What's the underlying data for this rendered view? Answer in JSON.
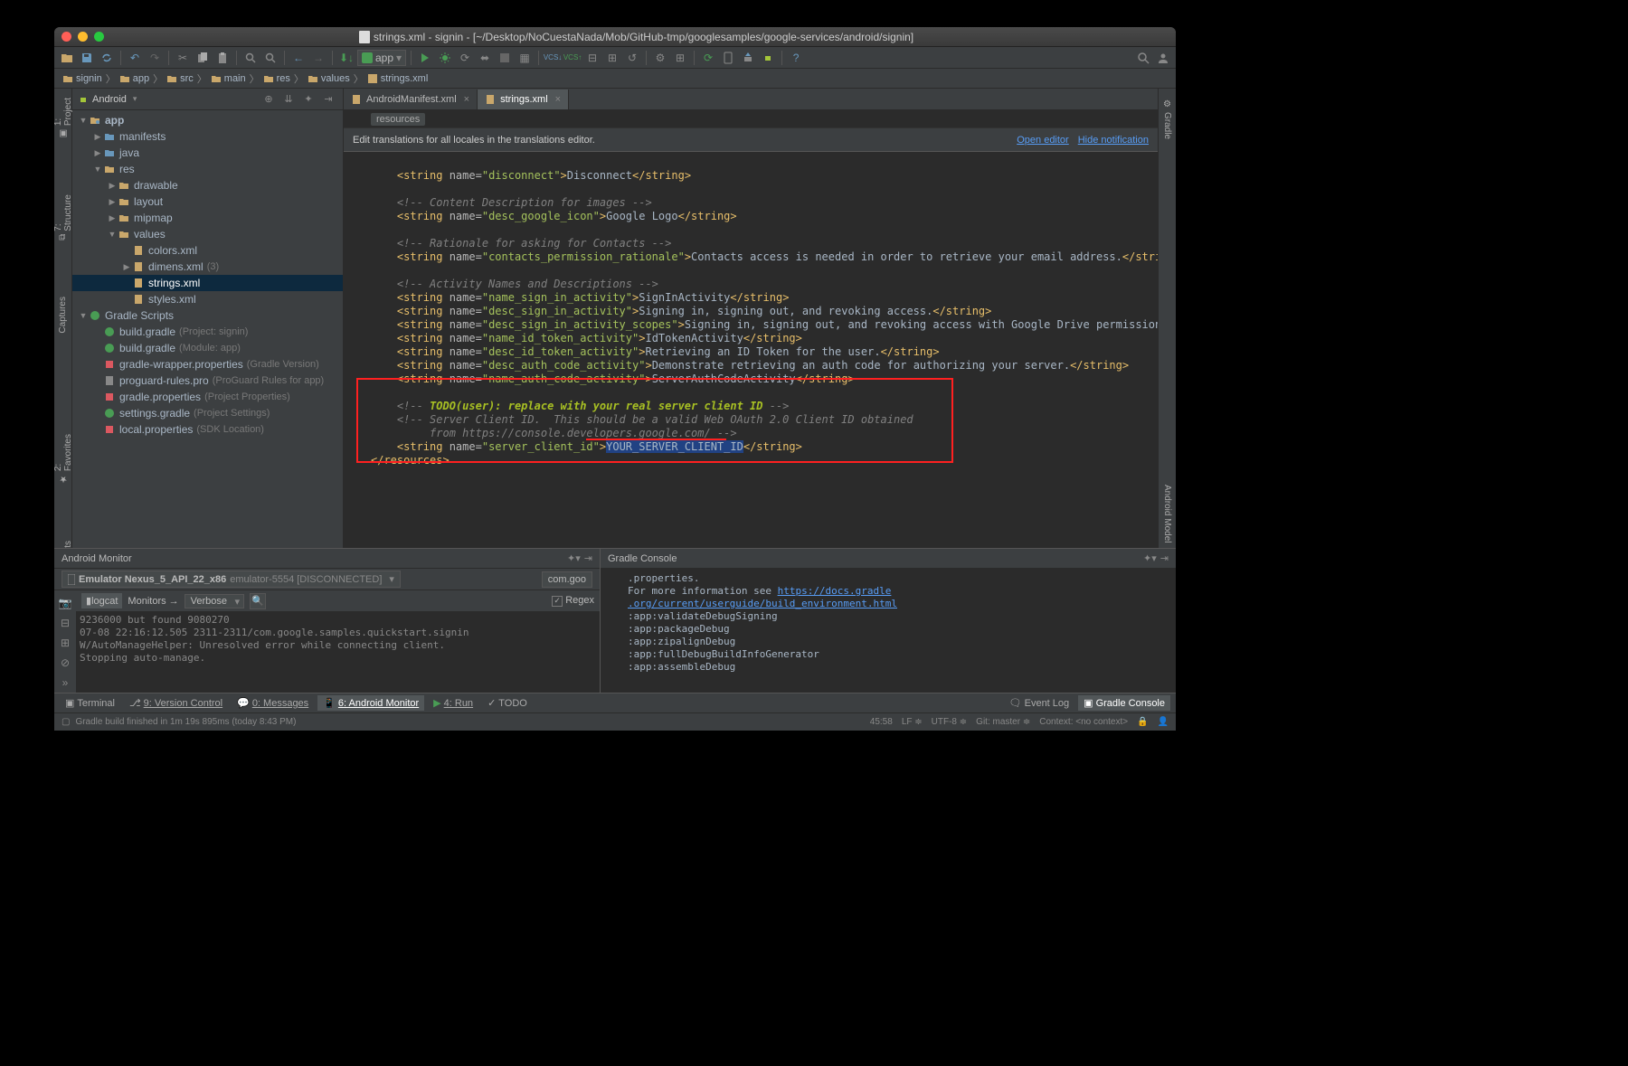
{
  "window": {
    "title": "strings.xml - signin - [~/Desktop/NoCuestaNada/Mob/GitHub-tmp/googlesamples/google-services/android/signin]"
  },
  "breadcrumbs": [
    "signin",
    "app",
    "src",
    "main",
    "res",
    "values",
    "strings.xml"
  ],
  "project": {
    "viewLabel": "Android",
    "tree": {
      "app": "app",
      "manifests": "manifests",
      "java": "java",
      "res": "res",
      "drawable": "drawable",
      "layout": "layout",
      "mipmap": "mipmap",
      "values": "values",
      "colors": "colors.xml",
      "dimens": "dimens.xml",
      "dimensCount": "(3)",
      "strings": "strings.xml",
      "styles": "styles.xml",
      "gradleScripts": "Gradle Scripts",
      "bg1": "build.gradle",
      "bg1q": "(Project: signin)",
      "bg2": "build.gradle",
      "bg2q": "(Module: app)",
      "gw": "gradle-wrapper.properties",
      "gwq": "(Gradle Version)",
      "pg": "proguard-rules.pro",
      "pgq": "(ProGuard Rules for app)",
      "gp": "gradle.properties",
      "gpq": "(Project Properties)",
      "sg": "settings.gradle",
      "sgq": "(Project Settings)",
      "lp": "local.properties",
      "lpq": "(SDK Location)"
    }
  },
  "tabs": {
    "t1": "AndroidManifest.xml",
    "t2": "strings.xml"
  },
  "struct": "resources",
  "notice": {
    "text": "Edit translations for all locales in the translations editor.",
    "a1": "Open editor",
    "a2": "Hide notification"
  },
  "code": {
    "l1": "Disconnect",
    "l2": "Content Description for images",
    "l3": "Google Logo",
    "l4": "Rationale for asking for Contacts",
    "l5": "Contacts access is needed in order to retrieve your email address.",
    "l6": "Activity Names and Descriptions",
    "l7": "SignInActivity",
    "l8": "Signing in, signing out, and revoking access.",
    "l9": "Signing in, signing out, and revoking access with Google Drive permissions.",
    "l10": "IdTokenActivity",
    "l11": "Retrieving an ID Token for the user.",
    "l12": "Demonstrate retrieving an auth code for authorizing your server.",
    "l13": "ServerAuthCodeActivity",
    "l14": "TODO(user): replace with your real server client ID",
    "l15a": "Server Client ID.  This should be a valid Web OAuth 2.0 Client ID obtained",
    "l15b": "from https://console.developers.google.com/",
    "l16": "YOUR_SERVER_CLIENT_ID",
    "n1": "disconnect",
    "n3": "desc_google_icon",
    "n5": "contacts_permission_rationale",
    "n7": "name_sign_in_activity",
    "n8": "desc_sign_in_activity",
    "n9": "desc_sign_in_activity_scopes",
    "n10": "name_id_token_activity",
    "n11": "desc_id_token_activity",
    "n12": "desc_auth_code_activity",
    "n13": "name_auth_code_activity",
    "n16": "server_client_id"
  },
  "monitor": {
    "title": "Android Monitor",
    "device": "Emulator Nexus_5_API_22_x86",
    "deviceSuffix": "emulator-5554 [DISCONNECTED]",
    "process": "com.goo",
    "tabLogcat": "logcat",
    "tabMonitors": "Monitors",
    "verbose": "Verbose",
    "regex": "Regex",
    "log1": "9236000 but found 9080270",
    "log2": "07-08 22:16:12.505 2311-2311/com.google.samples.quickstart.signin",
    "log3": "W/AutoManageHelper: Unresolved error while connecting client.",
    "log4": "Stopping auto-manage."
  },
  "gradle": {
    "title": "Gradle Console",
    "l1": ".properties.",
    "l2": "For more information see ",
    "link1": "https://docs.gradle",
    "link2": ".org/current/userguide/build_environment.html",
    "t1": ":app:validateDebugSigning",
    "t2": ":app:packageDebug",
    "t3": ":app:zipalignDebug",
    "t4": ":app:fullDebugBuildInfoGenerator",
    "t5": ":app:assembleDebug"
  },
  "bottombar": {
    "terminal": "Terminal",
    "vcs": "9: Version Control",
    "messages": "0: Messages",
    "monitor": "6: Android Monitor",
    "run": "4: Run",
    "todo": "TODO",
    "eventlog": "Event Log",
    "gradleconsole": "Gradle Console"
  },
  "status": {
    "msg": "Gradle build finished in 1m 19s 895ms (today 8:43 PM)",
    "pos": "45:58",
    "le": "LF",
    "enc": "UTF-8",
    "git": "Git: master",
    "ctx": "Context: <no context>"
  },
  "lefttabs": {
    "project": "1: Project",
    "structure": "7: Structure",
    "captures": "Captures",
    "favorites": "2: Favorites",
    "buildvar": "Build Variants"
  },
  "righttabs": {
    "gradle": "Gradle",
    "model": "Android Model"
  },
  "runconfig": "app"
}
